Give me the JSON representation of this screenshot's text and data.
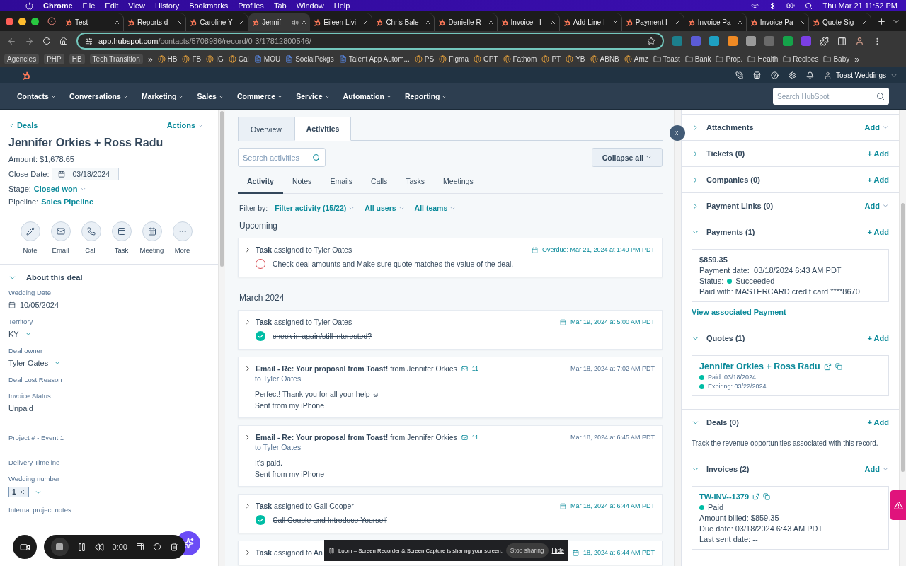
{
  "menubar": {
    "app": "Chrome",
    "menus": [
      "File",
      "Edit",
      "View",
      "History",
      "Bookmarks",
      "Profiles",
      "Tab",
      "Window",
      "Help"
    ],
    "clock": "Thu Mar 21  11:52 PM"
  },
  "browser_tabs": [
    {
      "label": "Test",
      "selected": false,
      "audio": false
    },
    {
      "label": "Reports d",
      "selected": false,
      "audio": false
    },
    {
      "label": "Caroline Y",
      "selected": false,
      "audio": false
    },
    {
      "label": "Jennif",
      "selected": true,
      "audio": true
    },
    {
      "label": "Eileen Livi",
      "selected": false,
      "audio": false
    },
    {
      "label": "Chris Bale",
      "selected": false,
      "audio": false
    },
    {
      "label": "Danielle R",
      "selected": false,
      "audio": false
    },
    {
      "label": "Invoice - I",
      "selected": false,
      "audio": false
    },
    {
      "label": "Add Line I",
      "selected": false,
      "audio": false
    },
    {
      "label": "Payment I",
      "selected": false,
      "audio": false
    },
    {
      "label": "Invoice Pa",
      "selected": false,
      "audio": false
    },
    {
      "label": "Invoice Pa",
      "selected": false,
      "audio": false
    },
    {
      "label": "Quote Sig",
      "selected": false,
      "audio": false
    }
  ],
  "address": {
    "host": "app.hubspot.com",
    "path": "/contacts/5708986/record/0-3/17812800546/"
  },
  "bookmarks": [
    {
      "label": "Agencies",
      "kind": "chip"
    },
    {
      "label": "PHP",
      "kind": "chip"
    },
    {
      "label": "HB",
      "kind": "chip"
    },
    {
      "label": "Tech Transition",
      "kind": "chip"
    },
    {
      "label": "»",
      "kind": "more"
    },
    {
      "label": "HB",
      "kind": "site"
    },
    {
      "label": "FB",
      "kind": "site"
    },
    {
      "label": "IG",
      "kind": "site"
    },
    {
      "label": "Cal",
      "kind": "site"
    },
    {
      "label": "MOU",
      "kind": "doc"
    },
    {
      "label": "SocialPckgs",
      "kind": "doc"
    },
    {
      "label": "Talent App Autom...",
      "kind": "doc"
    },
    {
      "label": "PS",
      "kind": "site"
    },
    {
      "label": "Figma",
      "kind": "site"
    },
    {
      "label": "GPT",
      "kind": "site"
    },
    {
      "label": "Fathom",
      "kind": "site"
    },
    {
      "label": "PT",
      "kind": "site"
    },
    {
      "label": "YB",
      "kind": "site"
    },
    {
      "label": "ABNB",
      "kind": "site"
    },
    {
      "label": "Amz",
      "kind": "site"
    },
    {
      "label": "Toast",
      "kind": "folder"
    },
    {
      "label": "Bank",
      "kind": "folder"
    },
    {
      "label": "Prop.",
      "kind": "folder"
    },
    {
      "label": "Health",
      "kind": "folder"
    },
    {
      "label": "Recipes",
      "kind": "folder"
    },
    {
      "label": "Baby",
      "kind": "folder"
    },
    {
      "label": "»",
      "kind": "more"
    }
  ],
  "hubspot": {
    "account": "Toast Weddings",
    "search_placeholder": "Search HubSpot",
    "nav": [
      "Contacts",
      "Conversations",
      "Marketing",
      "Sales",
      "Commerce",
      "Service",
      "Automation",
      "Reporting"
    ]
  },
  "record": {
    "back": "Deals",
    "actions": "Actions",
    "title": "Jennifer Orkies + Ross Radu",
    "amount_label": "Amount:",
    "amount": "$1,678.65",
    "close_date_label": "Close Date:",
    "close_date": "03/18/2024",
    "stage_label": "Stage:",
    "stage": "Closed won",
    "pipeline_label": "Pipeline:",
    "pipeline": "Sales Pipeline",
    "quick_actions": [
      "Note",
      "Email",
      "Call",
      "Task",
      "Meeting",
      "More"
    ],
    "about": {
      "title": "About this deal",
      "expanded": true,
      "properties": [
        {
          "label": "Wedding Date",
          "value": "10/05/2024",
          "kind": "date"
        },
        {
          "label": "Territory",
          "value": "KY",
          "kind": "dropdown"
        },
        {
          "label": "Deal owner",
          "value": "Tyler Oates",
          "kind": "dropdown"
        },
        {
          "label": "Deal Lost Reason",
          "kind": "empty"
        },
        {
          "label": "Invoice Status",
          "value": "Unpaid",
          "kind": "text"
        },
        {
          "label": "Project # - Event 1",
          "kind": "blank"
        },
        {
          "label": "Delivery Timeline",
          "kind": "empty"
        },
        {
          "label": "Wedding number",
          "value": "1",
          "kind": "tag"
        },
        {
          "label": "Internal project notes",
          "kind": "empty"
        }
      ]
    }
  },
  "activity": {
    "tabs": [
      {
        "label": "Overview",
        "selected": false
      },
      {
        "label": "Activities",
        "selected": true
      }
    ],
    "search_placeholder": "Search activities",
    "collapse": "Collapse all",
    "filters": [
      {
        "label": "Activity",
        "selected": true
      },
      {
        "label": "Notes",
        "selected": false
      },
      {
        "label": "Emails",
        "selected": false
      },
      {
        "label": "Calls",
        "selected": false
      },
      {
        "label": "Tasks",
        "selected": false
      },
      {
        "label": "Meetings",
        "selected": false
      }
    ],
    "filter_by": "Filter by:",
    "filter_menus": [
      "Filter activity (15/22)",
      "All users",
      "All teams"
    ],
    "groups": [
      {
        "title": "Upcoming",
        "items": [
          {
            "kind": "task",
            "type": "Task",
            "meta": "assigned to Tyler Oates",
            "date": "Overdue: Mar 21, 2024 at 1:40 PM PDT",
            "subject": "Check deal amounts and Make sure quote matches the value of the deal.",
            "done": false
          }
        ]
      },
      {
        "title": "March 2024",
        "items": [
          {
            "kind": "task",
            "type": "Task",
            "meta": "assigned to Tyler Oates",
            "date": "Mar 19, 2024 at 5:00 AM PDT",
            "subject": "check in again/still interested?",
            "done": true
          },
          {
            "kind": "email",
            "type": "Email - Re: Your proposal from Toast!",
            "meta": "from Jennifer Orkies",
            "count": "11",
            "to": "to Tyler Oates",
            "date": "Mar 18, 2024 at 7:02 AM PDT",
            "body": [
              "Perfect! Thank you for all your help ☺",
              "Sent from my iPhone"
            ]
          },
          {
            "kind": "email",
            "type": "Email - Re: Your proposal from Toast!",
            "meta": "from Jennifer Orkies",
            "count": "11",
            "to": "to Tyler Oates",
            "date": "Mar 18, 2024 at 6:45 AM PDT",
            "body": [
              "It’s paid.",
              "Sent from my iPhone"
            ]
          },
          {
            "kind": "task",
            "type": "Task",
            "meta": "assigned to Gail Cooper",
            "date": "Mar 18, 2024 at 6:44 AM PDT",
            "subject": "Call Couple and Introduce Yourself",
            "done": true
          },
          {
            "kind": "task",
            "type": "Task",
            "meta": "assigned to An",
            "date": "18, 2024 at 6:44 AM PDT"
          }
        ]
      }
    ]
  },
  "sidebar": [
    {
      "kind": "collapsed",
      "title": "Attachments",
      "expanded": false,
      "add": "Add",
      "add_menu": true
    },
    {
      "kind": "collapsed",
      "title": "Tickets (0)",
      "expanded": false,
      "add": "+ Add",
      "add_menu": false
    },
    {
      "kind": "collapsed",
      "title": "Companies (0)",
      "expanded": false,
      "add": "+ Add",
      "add_menu": false
    },
    {
      "kind": "collapsed",
      "title": "Payment Links (0)",
      "expanded": false,
      "add": "Add",
      "add_menu": true
    },
    {
      "kind": "payments",
      "title": "Payments (1)",
      "expanded": true,
      "add": "+ Add",
      "add_menu": false,
      "amount": "$859.35",
      "rows": [
        {
          "label": "Payment date:",
          "value": "03/18/2024 6:43 AM PDT"
        },
        {
          "label": "Paid with:",
          "value": "MASTERCARD credit card ****8670"
        }
      ],
      "status": {
        "label": "Status:",
        "value": "Succeeded",
        "color": "#00bda5"
      },
      "link": "View associated Payment"
    },
    {
      "kind": "quotes",
      "title": "Quotes (1)",
      "expanded": true,
      "add": "+ Add",
      "add_menu": false,
      "quote": "Jennifer Orkies + Ross Radu",
      "statuses": [
        {
          "label": "Paid: 03/18/2024",
          "color": "#00bda5"
        },
        {
          "label": "Expiring: 03/22/2024",
          "color": "#00bda5"
        }
      ]
    },
    {
      "kind": "text",
      "title": "Deals (0)",
      "expanded": true,
      "add": "+ Add",
      "add_menu": false,
      "text": "Track the revenue opportunities associated with this record."
    },
    {
      "kind": "invoices",
      "title": "Invoices (2)",
      "expanded": true,
      "add": "Add",
      "add_menu": true,
      "number": "TW-INV--1379",
      "status": {
        "label": "Paid",
        "color": "#00bda5"
      },
      "lines": [
        "Amount billed: $859.35",
        "Due date: 03/18/2024 6:43 AM PDT",
        "Last sent date: --"
      ]
    }
  ],
  "recorder": {
    "time": "0:00"
  },
  "share_banner": {
    "text": "Loom – Screen Recorder & Screen Capture is sharing your screen.",
    "stop": "Stop sharing",
    "hide": "Hide"
  }
}
